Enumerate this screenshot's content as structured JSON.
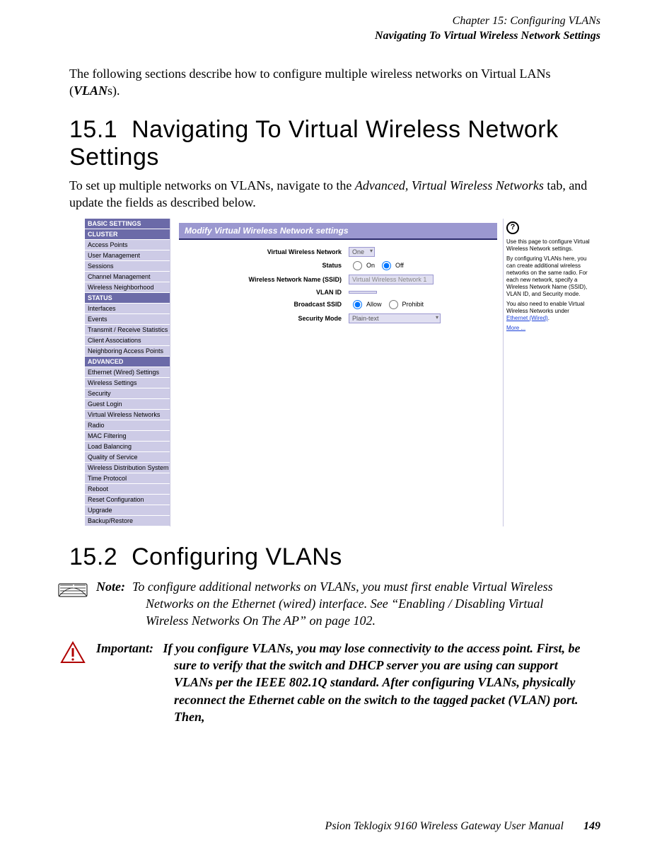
{
  "header": {
    "chapter": "Chapter 15:  Configuring VLANs",
    "section": "Navigating To Virtual Wireless Network Settings"
  },
  "intro": "The following sections describe how to configure multiple wireless networks on Virtual LANs (",
  "intro_em": "VLAN",
  "intro_tail": "s).",
  "s1_num": "15.1",
  "s1_title": "Navigating To Virtual Wireless Network Settings",
  "s1_body_a": "To set up multiple networks on VLANs, navigate to the ",
  "s1_body_em": "Advanced, Virtual Wireless Networks",
  "s1_body_b": " tab, and update the fields as described below.",
  "shot": {
    "sidebar": {
      "basic_hdr": "BASIC SETTINGS",
      "cluster_hdr": "CLUSTER",
      "cluster_items": [
        "Access Points",
        "User Management",
        "Sessions",
        "Channel Management",
        "Wireless Neighborhood"
      ],
      "status_hdr": "STATUS",
      "status_items": [
        "Interfaces",
        "Events",
        "Transmit / Receive Statistics",
        "Client Associations",
        "Neighboring Access Points"
      ],
      "advanced_hdr": "ADVANCED",
      "advanced_items": [
        "Ethernet (Wired) Settings",
        "Wireless Settings",
        "Security",
        "Guest Login",
        "Virtual Wireless Networks",
        "Radio",
        "MAC Filtering",
        "Load Balancing",
        "Quality of Service",
        "Wireless Distribution System",
        "Time Protocol",
        "Reboot",
        "Reset Configuration",
        "Upgrade",
        "Backup/Restore"
      ]
    },
    "main": {
      "title": "Modify Virtual Wireless Network settings",
      "row_vwn": "Virtual Wireless Network",
      "vwn_sel": "One",
      "row_status": "Status",
      "status_on": "On",
      "status_off": "Off",
      "row_ssid": "Wireless Network Name (SSID)",
      "ssid_val": "Virtual Wireless Network 1",
      "row_vlan": "VLAN ID",
      "vlan_val": "",
      "row_bcast": "Broadcast SSID",
      "bcast_allow": "Allow",
      "bcast_prohibit": "Prohibit",
      "row_sec": "Security Mode",
      "sec_val": "Plain-text"
    },
    "help": {
      "p1": "Use this page to configure Virtual Wireless Network settings.",
      "p2": "By configuring VLANs here, you can create additional wireless networks on the same radio. For each new network, specify a Wireless Network Name (SSID), VLAN ID, and Security mode.",
      "p3a": "You also need to enable Virtual Wireless Networks under ",
      "p3link": "Ethernet (Wired)",
      "p3b": ".",
      "more": "More ..."
    }
  },
  "s2_num": "15.2",
  "s2_title": "Configuring VLANs",
  "note_label": "Note:",
  "note_body": "To configure additional networks on VLANs, you must first enable Virtual Wireless Networks on the Ethernet (wired) interface. See “Enabling / Disabling Virtual Wireless Networks On The AP” on page 102.",
  "imp_label": "Important:",
  "imp_body": "If you configure VLANs, you may lose connectivity to the access point. First, be sure to verify that the switch and DHCP server you are using can support VLANs per the IEEE 802.1Q standard. After configuring VLANs, physically reconnect the Ethernet cable on the switch to the tagged packet (VLAN) port. Then,",
  "footer_text": "Psion Teklogix 9160 Wireless Gateway User Manual",
  "footer_page": "149"
}
